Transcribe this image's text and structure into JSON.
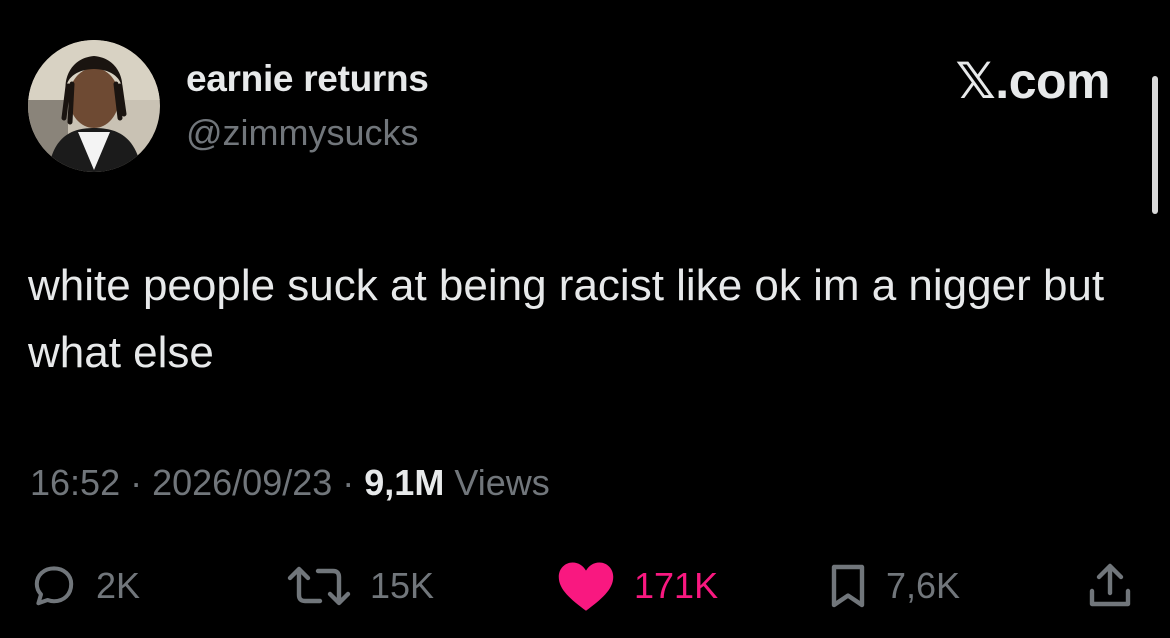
{
  "author": {
    "display_name": "earnie returns",
    "handle": "@zimmysucks",
    "avatar_icon": "profile-photo"
  },
  "brand": "𝕏.com",
  "tweet": {
    "text": "white people suck at being racist like ok im a nigger but what else"
  },
  "meta": {
    "time": "16:52",
    "date": "2026/09/23",
    "separator": " · ",
    "views_count": "9,1M",
    "views_label": "Views"
  },
  "actions": {
    "replies": "2K",
    "reposts": "15K",
    "likes": "171K",
    "bookmarks": "7,6K"
  },
  "colors": {
    "background": "#000000",
    "text_primary": "#e7e9ea",
    "text_secondary": "#71767b",
    "like": "#f91880"
  },
  "icons": [
    "reply-icon",
    "repost-icon",
    "heart-icon",
    "bookmark-icon",
    "share-icon"
  ]
}
